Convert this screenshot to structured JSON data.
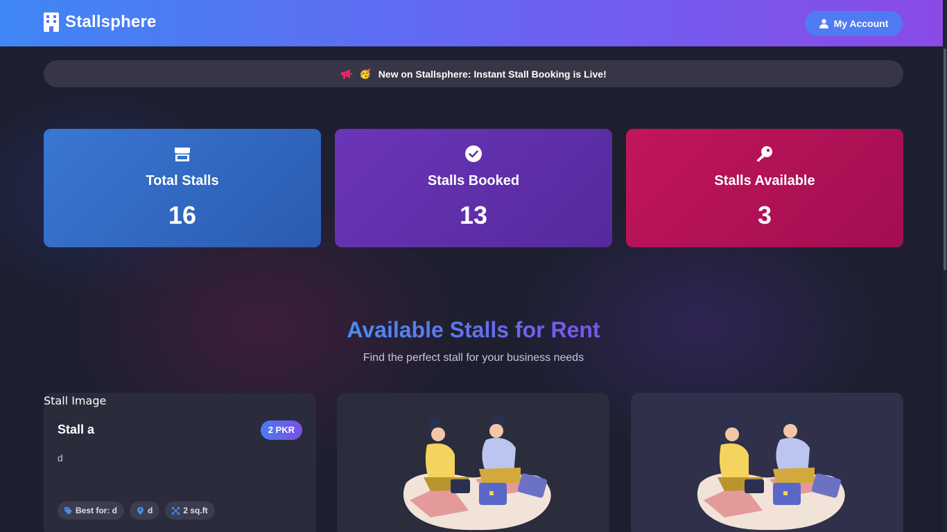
{
  "app": {
    "name": "Stallsphere"
  },
  "header": {
    "account_label": "My Account"
  },
  "announcement": {
    "emoji": "🥳",
    "text": "New on Stallsphere: Instant Stall Booking is Live!"
  },
  "stats": [
    {
      "label": "Total Stalls",
      "value": "16",
      "icon": "store-icon",
      "color": "#3977d4"
    },
    {
      "label": "Stalls Booked",
      "value": "13",
      "icon": "check-circle-icon",
      "color": "#6b35b8"
    },
    {
      "label": "Stalls Available",
      "value": "3",
      "icon": "key-icon",
      "color": "#c2155c"
    }
  ],
  "section": {
    "title": "Available Stalls for Rent",
    "subtitle": "Find the perfect stall for your business needs"
  },
  "stalls": [
    {
      "image_alt": "Stall Image",
      "name": "Stall a",
      "price": "2 PKR",
      "description": "d",
      "tags": {
        "best_for": "Best for: d",
        "location": "d",
        "size": "2 sq.ft"
      }
    }
  ],
  "colors": {
    "accent_blue": "#3f87f5",
    "accent_purple": "#8a4ae8",
    "background": "#1d1f2f"
  }
}
